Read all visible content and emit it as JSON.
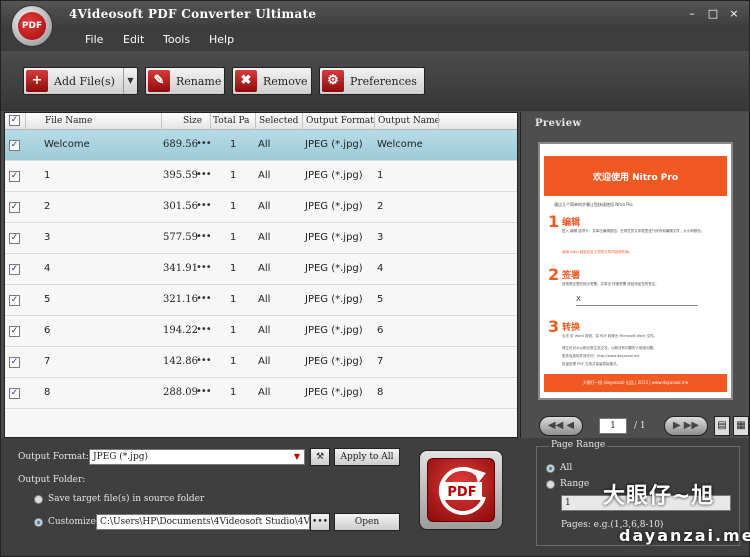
{
  "app": {
    "title": "4Videosoft PDF Converter Ultimate",
    "logo_text": "PDF",
    "window_controls": [
      "–",
      "□",
      "×"
    ]
  },
  "menu": [
    "File",
    "Edit",
    "Tools",
    "Help"
  ],
  "toolbar": {
    "add_files": "Add File(s)",
    "rename": "Rename",
    "remove": "Remove",
    "preferences": "Preferences"
  },
  "table": {
    "headers": {
      "file_name": "File Name",
      "size": "Size",
      "total_pages": "Total Pa",
      "selected": "Selected",
      "output_format": "Output Format",
      "output_name": "Output Name"
    },
    "rows": [
      {
        "name": "Welcome",
        "size": "689.56",
        "total": "1",
        "selected": "All",
        "format": "JPEG (*.jpg)",
        "output": "Welcome"
      },
      {
        "name": "1",
        "size": "395.59",
        "total": "1",
        "selected": "All",
        "format": "JPEG (*.jpg)",
        "output": "1"
      },
      {
        "name": "2",
        "size": "301.56",
        "total": "1",
        "selected": "All",
        "format": "JPEG (*.jpg)",
        "output": "2"
      },
      {
        "name": "3",
        "size": "577.59",
        "total": "1",
        "selected": "All",
        "format": "JPEG (*.jpg)",
        "output": "3"
      },
      {
        "name": "4",
        "size": "341.91",
        "total": "1",
        "selected": "All",
        "format": "JPEG (*.jpg)",
        "output": "4"
      },
      {
        "name": "5",
        "size": "321.16",
        "total": "1",
        "selected": "All",
        "format": "JPEG (*.jpg)",
        "output": "5"
      },
      {
        "name": "6",
        "size": "194.22",
        "total": "1",
        "selected": "All",
        "format": "JPEG (*.jpg)",
        "output": "6"
      },
      {
        "name": "7",
        "size": "142.86",
        "total": "1",
        "selected": "All",
        "format": "JPEG (*.jpg)",
        "output": "7"
      },
      {
        "name": "8",
        "size": "288.09",
        "total": "1",
        "selected": "All",
        "format": "JPEG (*.jpg)",
        "output": "8"
      }
    ]
  },
  "preview": {
    "label": "Preview",
    "page_current": "1",
    "page_total": "/ 1",
    "doc": {
      "heading": "欢迎使用 Nitro Pro",
      "intro": "通过几个简单的步骤让您快速使用 Nitro Pro",
      "s1_num": "1",
      "s1_title": "编辑",
      "s1_body": "进入 编辑 选项卡，并单击编辑按钮。在现在的文本框里进行修改和编辑文件，大小和颜色。",
      "s1_note": "使用 Nitro 轻松自定义您的文件内容和布局。",
      "s2_num": "2",
      "s2_title": "签署",
      "s2_body": "请按照这里的指示签署，并单击 快速签署 按钮添加您的签名。",
      "s2_x": "X",
      "s3_num": "3",
      "s3_title": "转换",
      "s3_body": "点击 至 Word 按钮，将 PDF 转换为 Microsoft Word 文件。",
      "more_1": "博主也对大以和长常生态交流，以解决有问题的人使用问题。",
      "more_2": "更多免费软件请访问：http://www.dayanzai.me",
      "more_3": "批量处理 PDF 文档并保留原始格式。",
      "footer": "大眼仔~旭 (dayanzai) 出品 | 2013 | www.dayanzai.me"
    }
  },
  "output": {
    "format_label": "Output Format:",
    "format_value": "JPEG (*.jpg)",
    "apply_all": "Apply to All",
    "folder_label": "Output Folder:",
    "save_source": "Save target file(s) in source folder",
    "customize": "Customize:",
    "path": "C:\\Users\\HP\\Documents\\4Videosoft Studio\\4Video",
    "browse": "•••",
    "open": "Open"
  },
  "page_range": {
    "label": "Page Range",
    "all": "All",
    "range": "Range",
    "range_value": "1",
    "pages_hint": "Pages: e.g.(1,3,6,8-10)"
  },
  "watermark": {
    "cn": "大眼仔~旭",
    "en": "dayanzai.me"
  }
}
